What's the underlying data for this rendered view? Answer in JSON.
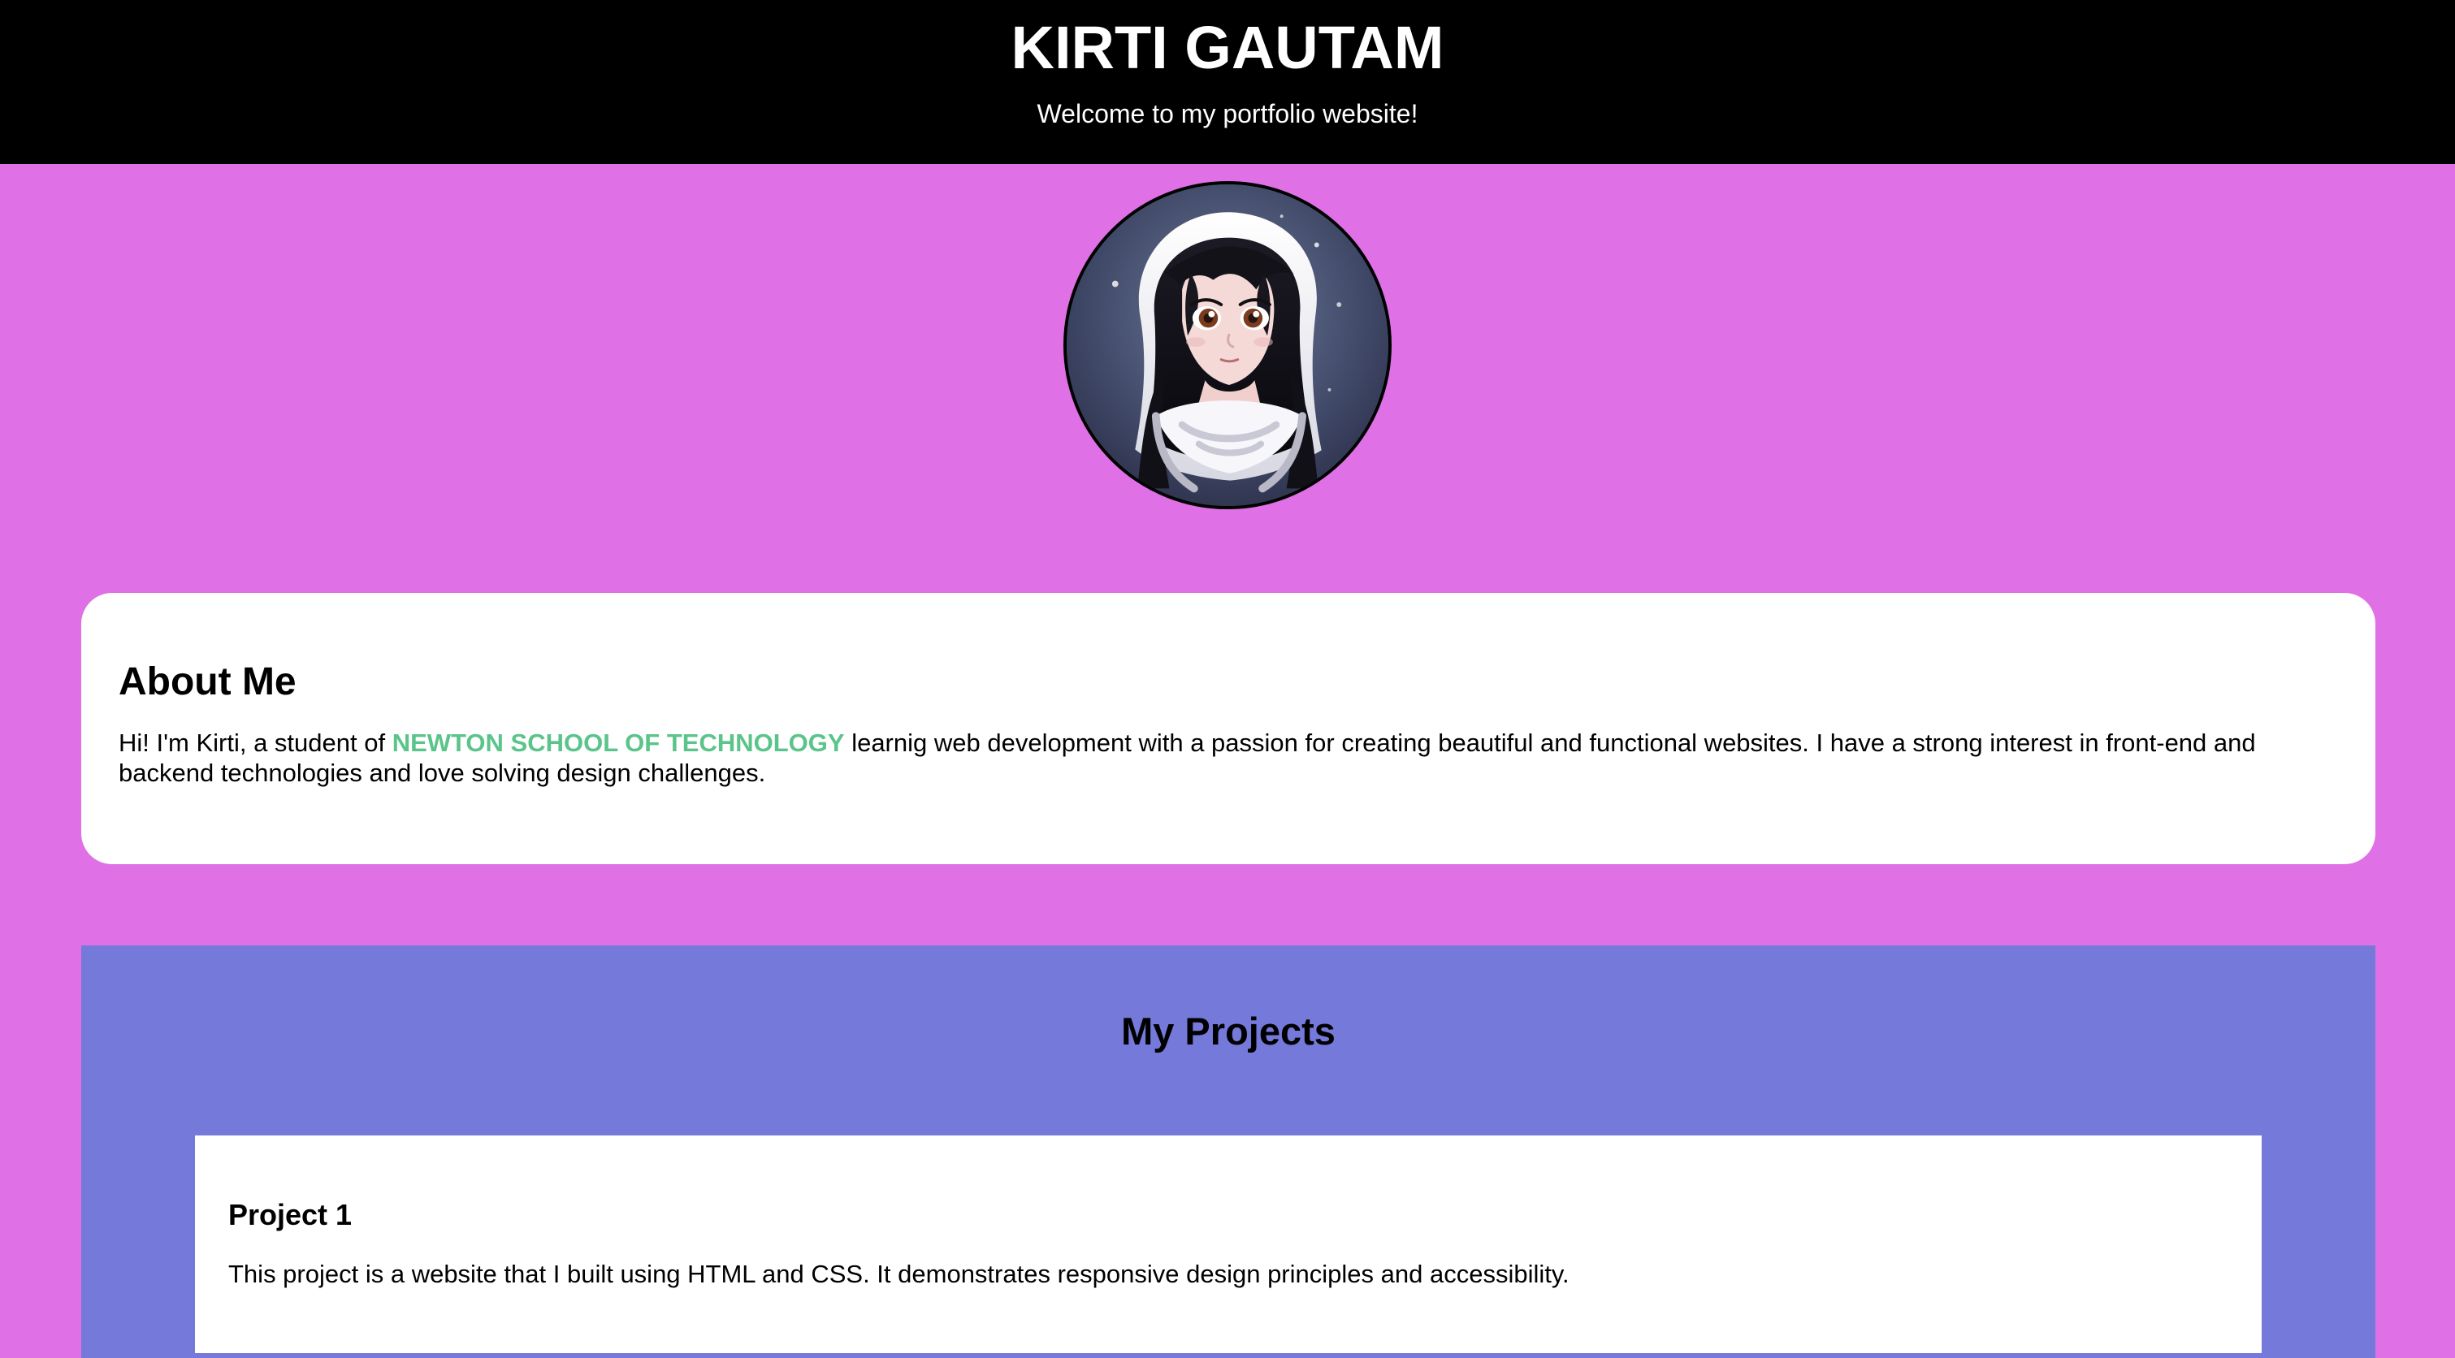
{
  "header": {
    "title": "KIRTI GAUTAM",
    "tagline": "Welcome to my portfolio website!"
  },
  "about": {
    "title": "About Me",
    "intro_before_school": "Hi! I'm Kirti, a student of ",
    "school": "NEWTON SCHOOL OF TECHNOLOGY",
    "intro_after_school": " learnig web development with a passion for creating beautiful and functional websites. I have a strong interest in front-end and backend technologies and love solving design challenges."
  },
  "projects": {
    "title": "My Projects",
    "items": [
      {
        "title": "Project 1",
        "description": "This project is a website that I built using HTML and CSS. It demonstrates responsive design principles and accessibility."
      }
    ]
  },
  "colors": {
    "page_background": "#e070e5",
    "header_background": "#000000",
    "about_card_background": "#ffffff",
    "projects_background": "#7479da",
    "school_highlight": "#5ac48a"
  }
}
